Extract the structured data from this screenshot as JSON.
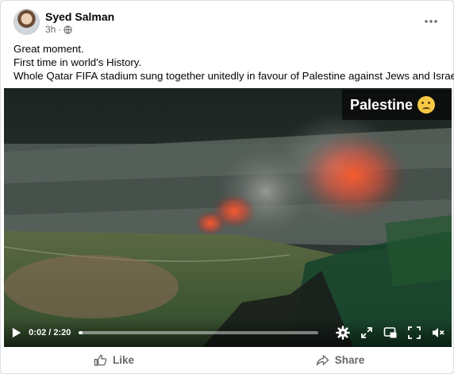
{
  "post": {
    "author": "Syed Salman",
    "time": "3h",
    "separator": "·",
    "privacy_icon": "globe-icon",
    "more_icon": "more-options-icon",
    "more_label": "•••",
    "text_lines": [
      "Great moment.",
      "First time in world's History.",
      "Whole Qatar FIFA stadium sung together unitedly in favour of Palestine against Jews and Israel.👇"
    ]
  },
  "video": {
    "overlay_label": "Palestine",
    "overlay_emoji": "crying-face-icon",
    "current_time": "0:02",
    "duration": "2:20",
    "time_text": "0:02 / 2:20",
    "progress_fraction": 0.0143,
    "controls": [
      "play-icon",
      "settings-icon",
      "expand-icon",
      "picture-in-picture-icon",
      "fullscreen-icon",
      "volume-muted-icon"
    ]
  },
  "actions": {
    "like_label": "Like",
    "share_label": "Share"
  },
  "colors": {
    "secondary_text": "#65676b",
    "card_bg": "#ffffff",
    "page_bg": "#f0f2f5"
  }
}
